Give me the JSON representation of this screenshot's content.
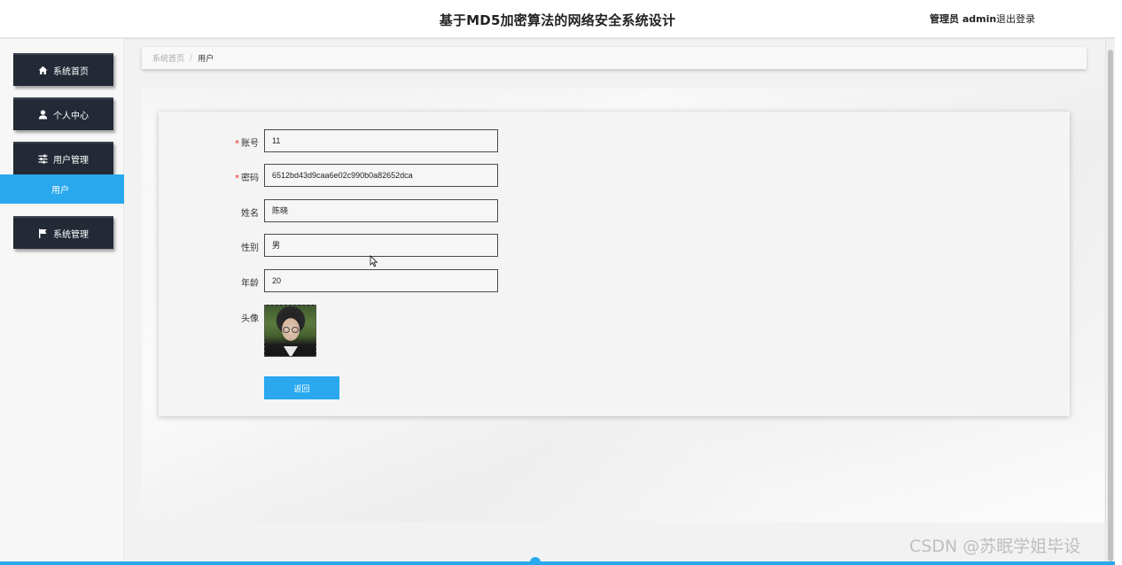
{
  "header": {
    "title": "基于MD5加密算法的网络安全系统设计",
    "user_text": "管理员 admin",
    "logout_label": "退出登录"
  },
  "sidebar": {
    "items": [
      {
        "label": "系统首页",
        "icon": "home-icon"
      },
      {
        "label": "个人中心",
        "icon": "user-icon"
      },
      {
        "label": "用户管理",
        "icon": "sliders-icon"
      },
      {
        "label": "系统管理",
        "icon": "flag-icon"
      }
    ],
    "active_sub_item": "用户"
  },
  "breadcrumb": {
    "home": "系统首页",
    "separator": "/",
    "current": "用户"
  },
  "form": {
    "fields": [
      {
        "label": "账号",
        "value": "11",
        "required": true
      },
      {
        "label": "密码",
        "value": "6512bd43d9caa6e02c990b0a82652dca",
        "required": true
      },
      {
        "label": "姓名",
        "value": "陈晓",
        "required": false
      },
      {
        "label": "性别",
        "value": "男",
        "required": false
      },
      {
        "label": "年龄",
        "value": "20",
        "required": false
      }
    ],
    "avatar_label": "头像",
    "required_mark": "*",
    "back_label": "返回"
  },
  "watermark": "CSDN @苏眠学姐毕设",
  "colors": {
    "accent": "#29a8ee",
    "sidebar_button": "#232a36",
    "required": "#ee2222"
  }
}
